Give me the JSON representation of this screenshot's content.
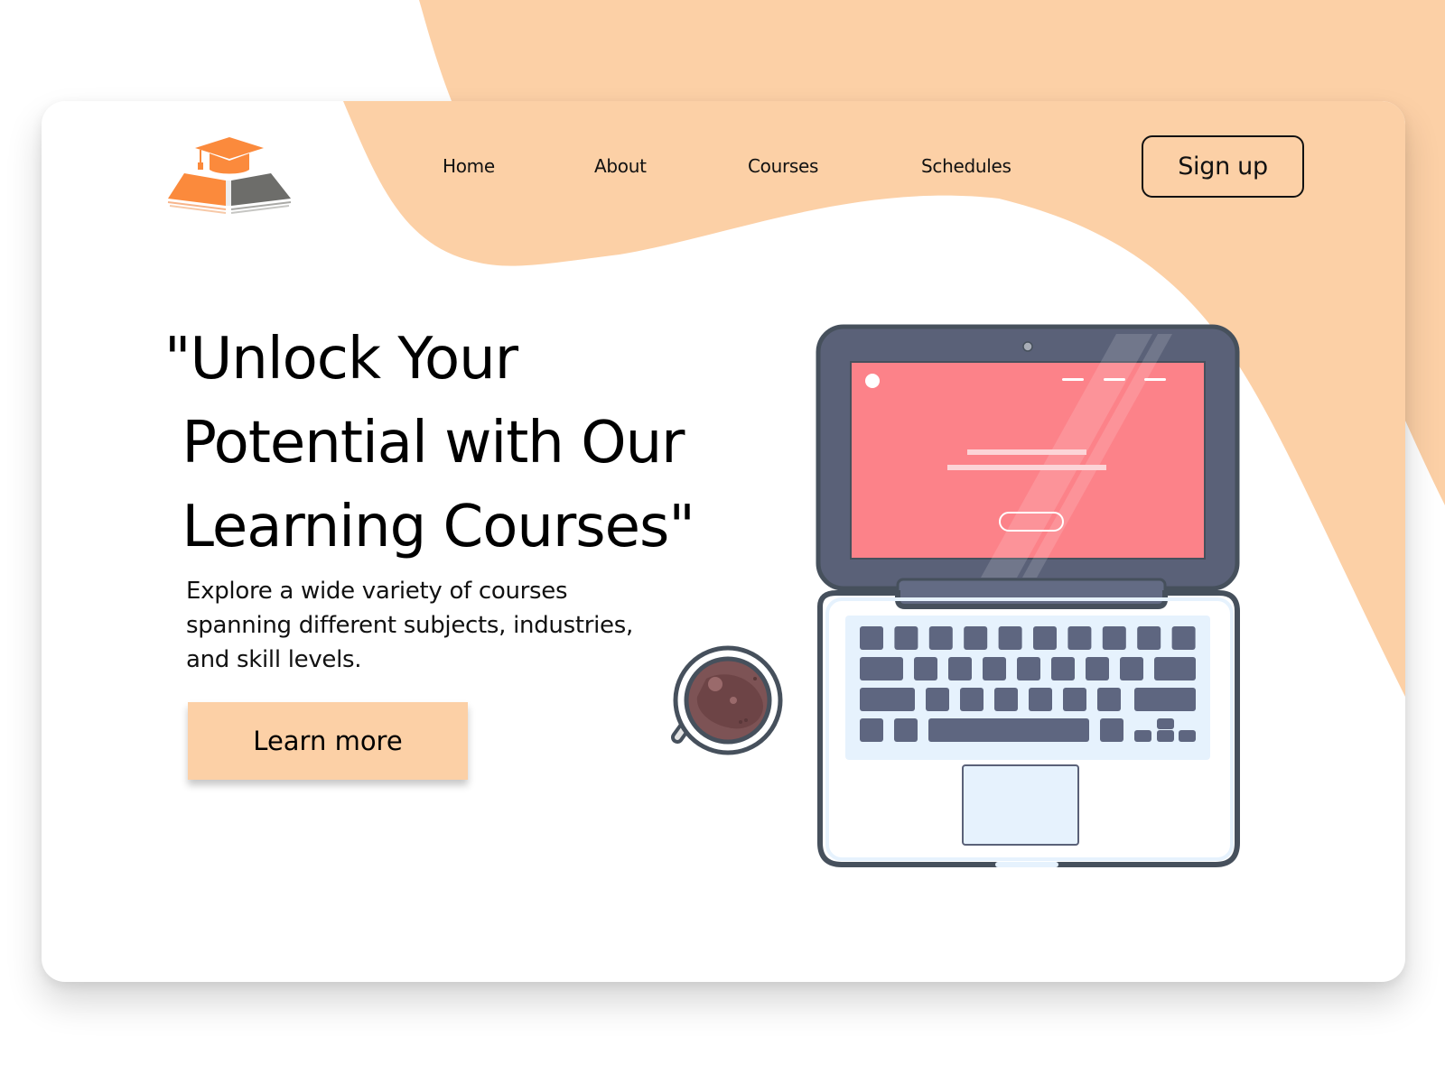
{
  "brand": {
    "logo_icon": "graduation-cap-on-open-book",
    "colors": {
      "accent_orange": "#fb8a3c",
      "logo_gray": "#6d6d6a",
      "peach": "#fcd0a6",
      "laptop_dark": "#5a6178",
      "screen_pink": "#fc8289",
      "keyboard_bg": "#e6f2fd"
    }
  },
  "nav": {
    "items": [
      {
        "label": "Home"
      },
      {
        "label": "About"
      },
      {
        "label": "Courses"
      },
      {
        "label": "Schedules"
      }
    ],
    "signup_label": "Sign up"
  },
  "hero": {
    "headline": "\"Unlock Your\n Potential with Our\n Learning Courses\"",
    "subtext": "Explore a wide variety of courses spanning different subjects, industries, and skill levels.",
    "cta_label": "Learn more"
  },
  "illustration": {
    "laptop": "laptop-icon",
    "cup": "coffee-cup-icon"
  }
}
